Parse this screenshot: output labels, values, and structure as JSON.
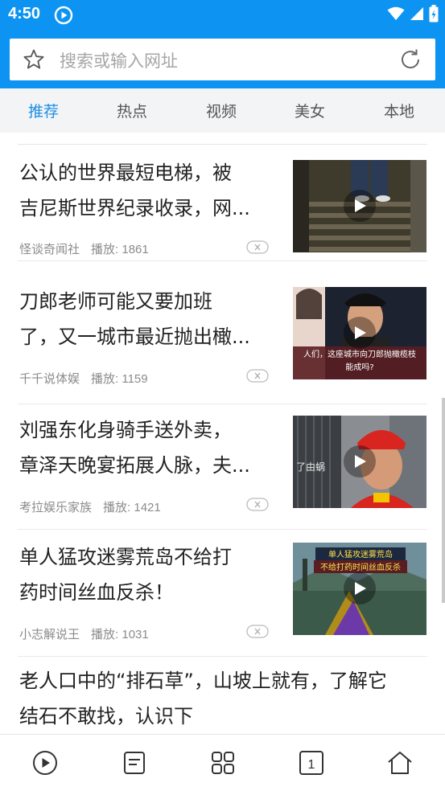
{
  "status_bar": {
    "time": "4:50"
  },
  "search": {
    "placeholder": "搜索或输入网址"
  },
  "tabs": [
    {
      "label": "推荐",
      "active": true
    },
    {
      "label": "热点",
      "active": false
    },
    {
      "label": "视频",
      "active": false
    },
    {
      "label": "美女",
      "active": false
    },
    {
      "label": "本地",
      "active": false
    }
  ],
  "feed": {
    "items": [
      {
        "title_line1": "公认的世界最短电梯，被",
        "title_line2": "吉尼斯世界纪录收录，网...",
        "source": "怪谈奇闻社",
        "plays": "播放: 1861",
        "thumb_caption": ""
      },
      {
        "title_line1": "刀郎老师可能又要加班",
        "title_line2": "了，又一城市最近抛出橄...",
        "source": "千千说体娱",
        "plays": "播放: 1159",
        "thumb_caption_line1": "人们，这座城市向刀郎抛橄榄枝",
        "thumb_caption_line2": "能成吗?"
      },
      {
        "title_line1": "刘强东化身骑手送外卖，",
        "title_line2": "章泽天晚宴拓展人脉，夫...",
        "source": "考拉娱乐家族",
        "plays": "播放: 1421",
        "thumb_sign": "了由蜗"
      },
      {
        "title_line1": "单人猛攻迷雾荒岛不给打",
        "title_line2": "药时间丝血反杀！",
        "source": "小志解说王",
        "plays": "播放: 1031",
        "thumb_caption_line1": "单人猛攻迷雾荒岛",
        "thumb_caption_line2": "不给打药时间丝血反杀"
      }
    ],
    "last_item": {
      "title_line1": "老人口中的“排石草”，山坡上就有，了解它",
      "title_line2": "结石不敢找，认识下"
    }
  },
  "bottom_nav": {
    "tab_count": "1"
  },
  "colors": {
    "brand_blue": "#0d94f2",
    "tab_active": "#1b8fe4"
  }
}
